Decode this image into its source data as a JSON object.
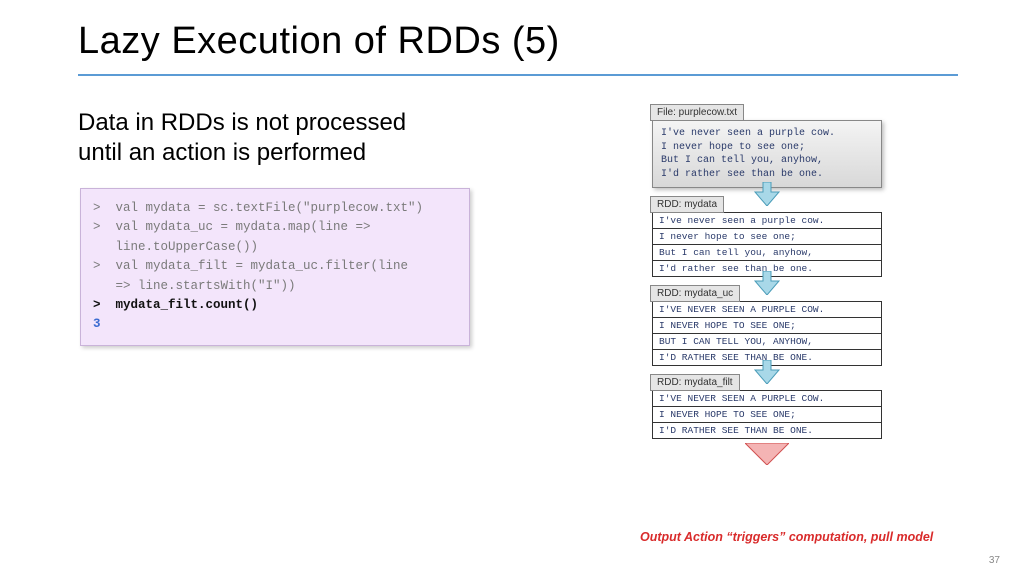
{
  "title": "Lazy Execution of RDDs (5)",
  "subtitle_l1": "Data in RDDs is not processed",
  "subtitle_l2": "until an action is performed",
  "code": {
    "l1": ">  val mydata = sc.textFile(\"purplecow.txt\")",
    "l2": ">  val mydata_uc = mydata.map(line =>",
    "l3": "   line.toUpperCase())",
    "l4": ">  val mydata_filt = mydata_uc.filter(line",
    "l5": "   => line.startsWith(\"I\"))",
    "l6": ">  mydata_filt.count()",
    "l7": "3"
  },
  "file": {
    "label": "File: purplecow.txt",
    "lines": [
      "I've never seen a purple cow.",
      "I never hope to see one;",
      "But I can tell you, anyhow,",
      "I'd rather see than be one."
    ]
  },
  "rdd1": {
    "label": "RDD: mydata",
    "rows": [
      "I've never seen a purple cow.",
      "I never hope to see one;",
      "But I can tell you, anyhow,",
      "I'd rather see than be one."
    ]
  },
  "rdd2": {
    "label": "RDD: mydata_uc",
    "rows": [
      "I'VE NEVER SEEN A PURPLE COW.",
      "I NEVER HOPE TO SEE ONE;",
      "BUT I CAN TELL YOU, ANYHOW,",
      "I'D RATHER SEE THAN BE ONE."
    ]
  },
  "rdd3": {
    "label": "RDD: mydata_filt",
    "rows": [
      "I'VE NEVER SEEN A PURPLE COW.",
      "I NEVER HOPE TO SEE ONE;",
      "I'D RATHER SEE THAN BE ONE."
    ]
  },
  "caption": "Output Action “triggers” computation, pull model",
  "pagenum": "37"
}
